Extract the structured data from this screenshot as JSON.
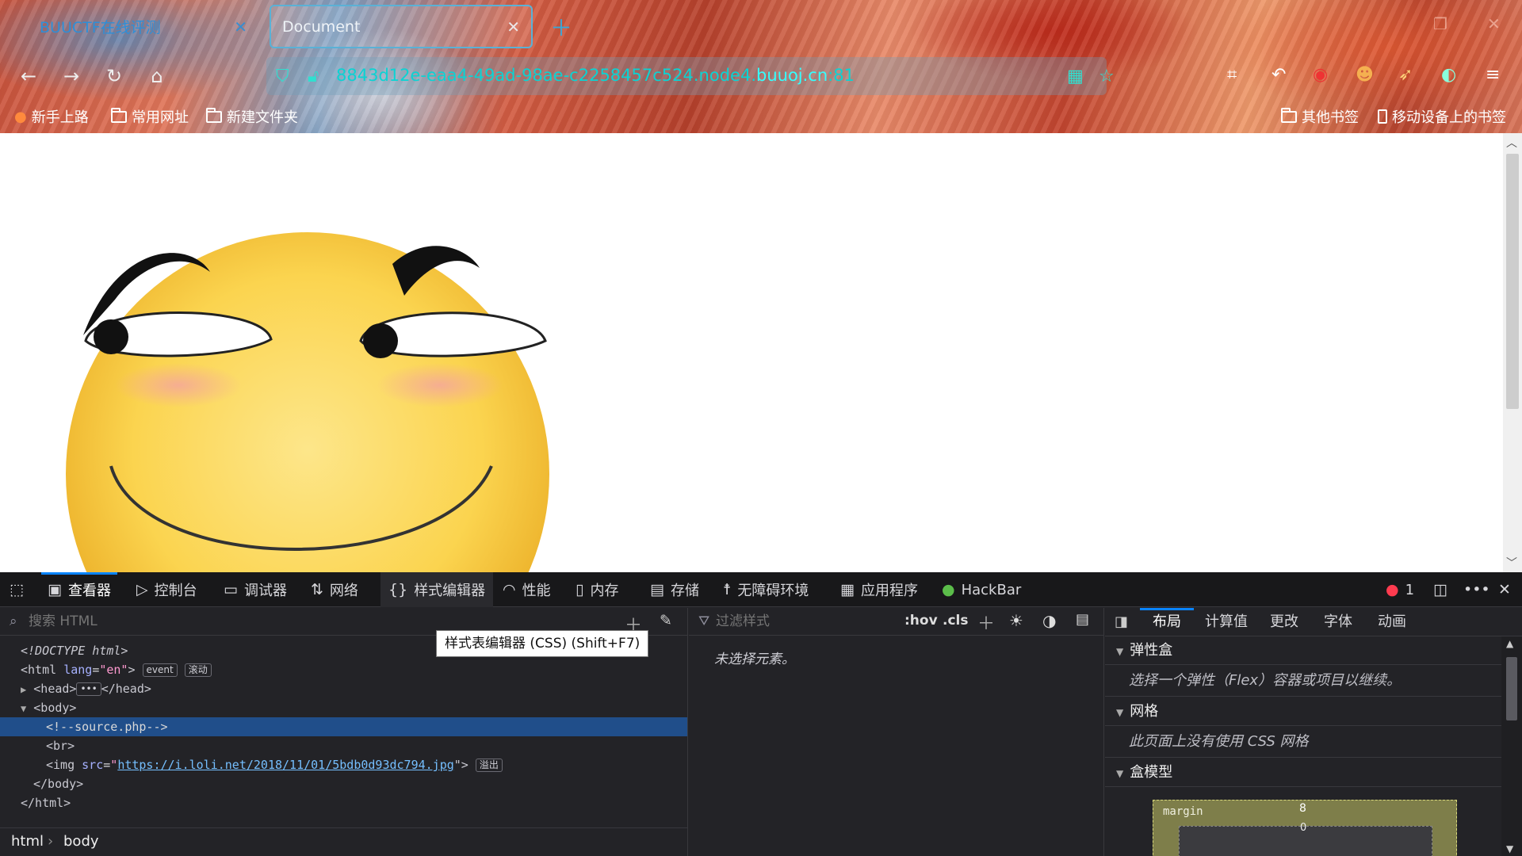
{
  "tabs": [
    {
      "label": "BUUCTF在线评测",
      "active": false
    },
    {
      "label": "Document",
      "active": true
    }
  ],
  "address": {
    "url_main": "8843d12e-eaa4-49ad-98ae-c2258457c524.node4.",
    "url_domain": "buuoj.cn",
    "url_port": ":81"
  },
  "bookmarks": {
    "left": [
      "新手上路",
      "常用网址",
      "新建文件夹"
    ],
    "right": [
      "其他书签",
      "移动设备上的书签"
    ]
  },
  "devtools": {
    "tabs": [
      "查看器",
      "控制台",
      "调试器",
      "网络",
      "样式编辑器",
      "性能",
      "内存",
      "存储",
      "无障碍环境",
      "应用程序",
      "HackBar"
    ],
    "error_count": "1",
    "tooltip": "样式表编辑器 (CSS) (Shift+F7)",
    "search_html_placeholder": "搜索 HTML",
    "filter_styles_placeholder": "过滤样式",
    "hov": ":hov",
    "cls": ".cls",
    "no_element": "未选择元素。",
    "markup": {
      "doctype": "<!DOCTYPE html>",
      "html_open_tag": "<html",
      "html_lang_attr": "lang",
      "html_lang_val": "\"en\"",
      "html_close_bracket": ">",
      "badge_event": "event",
      "badge_scroll": "滚动",
      "head_open": "<head>",
      "head_close": "</head>",
      "body_open": "<body>",
      "comment": "<!--source.php-->",
      "br": "<br>",
      "img_open": "<img",
      "img_src_attr": "src",
      "img_src": "https://i.loli.net/2018/11/01/5bdb0d93dc794.jpg",
      "img_close": "\">",
      "badge_overflow": "溢出",
      "body_close": "</body>",
      "html_close": "</html>"
    },
    "breadcrumbs": [
      "html",
      "body"
    ],
    "layout_tabs": [
      "布局",
      "计算值",
      "更改",
      "字体",
      "动画"
    ],
    "sections": {
      "flex_title": "弹性盒",
      "flex_body": "选择一个弹性（Flex）容器或项目以继续。",
      "grid_title": "网格",
      "grid_body": "此页面上没有使用 CSS 网格",
      "box_title": "盒模型"
    },
    "boxmodel": {
      "label": "margin",
      "top": "8",
      "inner": "0"
    }
  }
}
